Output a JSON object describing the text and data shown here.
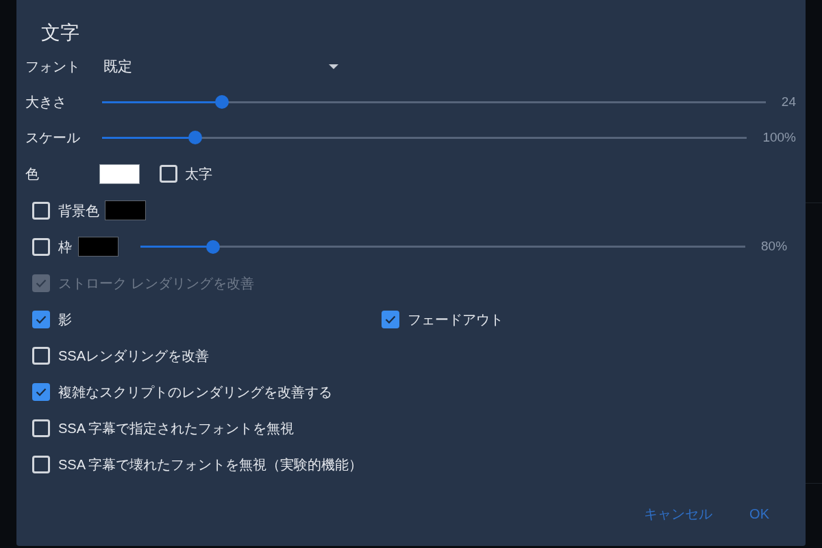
{
  "dialog": {
    "title": "文字",
    "font": {
      "label": "フォント",
      "value": "既定"
    },
    "sliders": [
      {
        "label": "大きさ",
        "level": 0.181,
        "reading": "24"
      },
      {
        "label": "スケール",
        "level": 0.144,
        "reading": "100%"
      }
    ],
    "text_color": {
      "label": "色",
      "color": "#ffffff",
      "bold": {
        "label": "太字",
        "checked": false
      }
    },
    "background": {
      "label": "背景色",
      "checked": false,
      "color": "#000000"
    },
    "outline": {
      "label": "枠",
      "checked": false,
      "color": "#000000",
      "level": 0.12,
      "reading": "80%"
    },
    "option_rows": [
      {
        "options": [
          {
            "label": "ストローク レンダリングを改善",
            "checked": true,
            "disabled": true
          }
        ]
      },
      {
        "options": [
          {
            "label": "影",
            "checked": true,
            "disabled": false
          },
          {
            "label": "フェードアウト",
            "checked": true,
            "disabled": false
          }
        ]
      },
      {
        "options": [
          {
            "label": "SSAレンダリングを改善",
            "checked": false,
            "disabled": false
          }
        ]
      },
      {
        "options": [
          {
            "label": "複雑なスクリプトのレンダリングを改善する",
            "checked": true,
            "disabled": false
          }
        ]
      },
      {
        "options": [
          {
            "label": "SSA 字幕で指定されたフォントを無視",
            "checked": false,
            "disabled": false
          }
        ]
      },
      {
        "options": [
          {
            "label": "SSA 字幕で壊れたフォントを無視（実験的機能）",
            "checked": false,
            "disabled": false
          }
        ]
      }
    ],
    "buttons": [
      {
        "label": "キャンセル"
      },
      {
        "label": "OK"
      }
    ]
  }
}
